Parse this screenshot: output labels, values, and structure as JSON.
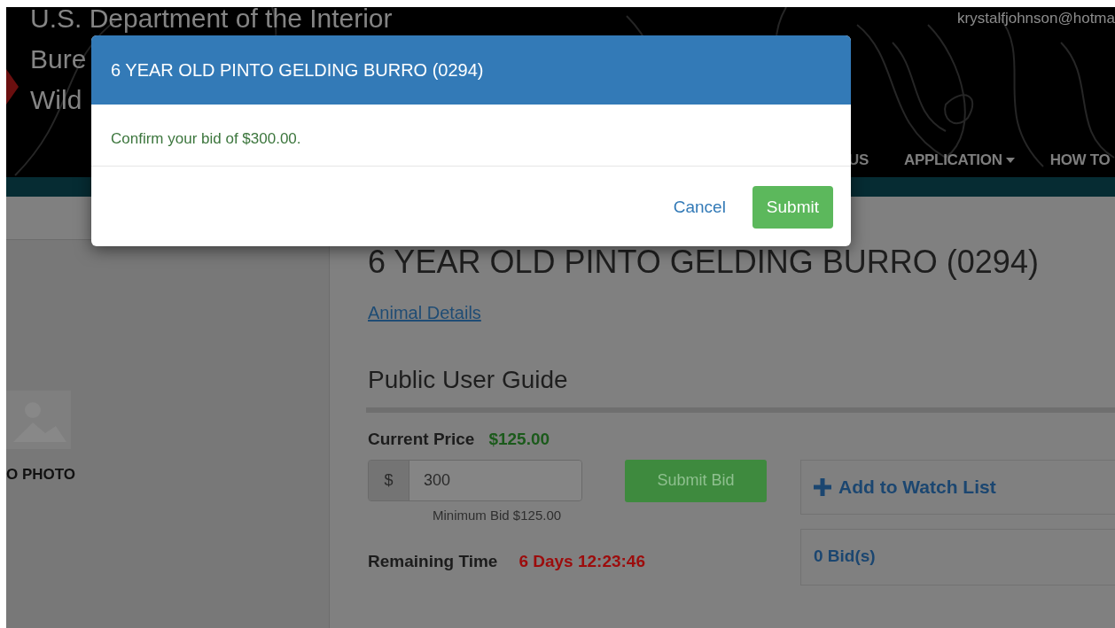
{
  "header": {
    "agency_lines": [
      "U.S. Department of the Interior",
      "Bure",
      "Wild"
    ],
    "user_email": "krystalfjohnson@hotma",
    "nav": [
      {
        "label": "US",
        "dropdown": false
      },
      {
        "label": "APPLICATION",
        "dropdown": true
      },
      {
        "label": "HOW TO",
        "dropdown": false
      }
    ]
  },
  "sidebar": {
    "photo_caption": "O PHOTO"
  },
  "animal": {
    "title": "6 YEAR OLD PINTO GELDING BURRO (0294)",
    "details_link": "Animal Details",
    "guide_title": "Public User Guide",
    "current_price_label": "Current Price",
    "current_price": "$125.00",
    "bid_currency": "$",
    "bid_value": "300",
    "minimum_bid": "Minimum Bid $125.00",
    "submit_bid_button": "Submit Bid",
    "watch_list_button": "Add to Watch List",
    "bid_count": "0 Bid(s)",
    "remaining_time_label": "Remaining Time",
    "remaining_time": "6 Days 12:23:46"
  },
  "modal": {
    "title": "6 YEAR OLD PINTO GELDING BURRO (0294)",
    "message": "Confirm your bid of $300.00.",
    "buttons": [
      {
        "label": "Cancel",
        "kind": "link"
      },
      {
        "label": "Submit",
        "kind": "primary"
      }
    ]
  }
}
